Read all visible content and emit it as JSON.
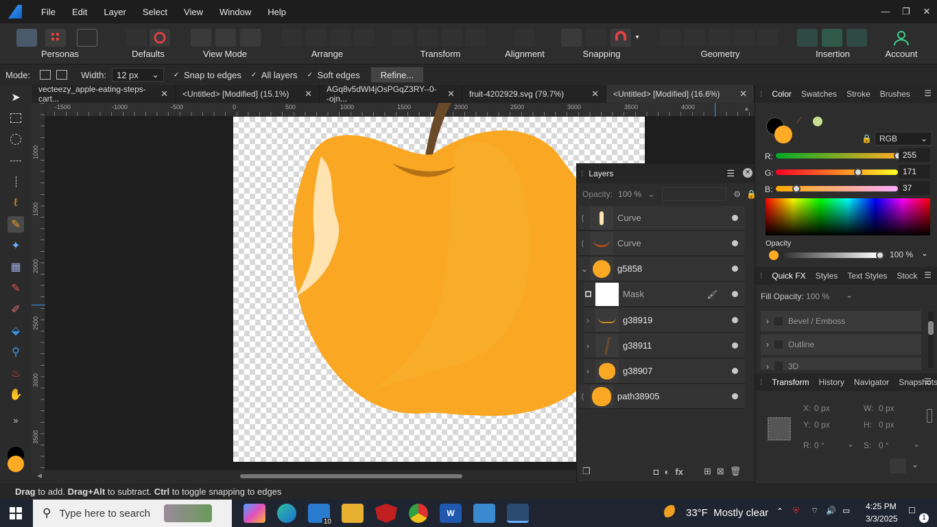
{
  "menu": {
    "items": [
      "File",
      "Edit",
      "Layer",
      "Select",
      "View",
      "Window",
      "Help"
    ],
    "win_min": "—",
    "win_max": "❐",
    "win_close": "✕"
  },
  "toolbar": {
    "personas_label": "Personas",
    "groups": [
      "Defaults",
      "View Mode",
      "Arrange",
      "Transform",
      "Alignment",
      "Snapping",
      "Geometry",
      "Insertion",
      "Account"
    ]
  },
  "context": {
    "mode_label": "Mode:",
    "width_label": "Width:",
    "width_value": "12 px",
    "snap_edges": "Snap to edges",
    "all_layers": "All layers",
    "soft_edges": "Soft edges",
    "refine": "Refine..."
  },
  "tabs": [
    {
      "label": "vecteezy_apple-eating-steps-cart...",
      "close": "✕"
    },
    {
      "label": "<Untitled> [Modified] (15.1%)",
      "close": "✕"
    },
    {
      "label": "AGq8v5dWl4jOsPGqZ3RY--0--ojn...",
      "close": "✕"
    },
    {
      "label": "fruit-4202929.svg (79.7%)",
      "close": "✕"
    },
    {
      "label": "<Untitled> [Modified] (16.6%)",
      "close": "✕"
    }
  ],
  "ruler": {
    "unit": "px",
    "h_ticks": [
      "-1500",
      "-1000",
      "-500",
      "0",
      "500",
      "1000",
      "1500",
      "2000",
      "2500",
      "3000",
      "3500",
      "4000"
    ],
    "v_ticks": [
      "1000",
      "1500",
      "2000",
      "2500",
      "3000",
      "3500"
    ]
  },
  "layers": {
    "title": "Layers",
    "opacity_label": "Opacity:",
    "opacity_value": "100 %",
    "rows": [
      {
        "name": "Curve"
      },
      {
        "name": "Curve"
      },
      {
        "name": "g5858"
      },
      {
        "name": "Mask"
      },
      {
        "name": "g38919"
      },
      {
        "name": "g38911"
      },
      {
        "name": "g38907"
      },
      {
        "name": "path38905"
      }
    ]
  },
  "color_panel": {
    "tabs": [
      "Color",
      "Swatches",
      "Stroke",
      "Brushes"
    ],
    "model": "RGB",
    "r_label": "R:",
    "g_label": "G:",
    "b_label": "B:",
    "r": "255",
    "g": "171",
    "b": "37",
    "opacity_label": "Opacity",
    "opacity_value": "100 %",
    "fill_color": "#FFAB25"
  },
  "fx_panel": {
    "tabs": [
      "Quick FX",
      "Styles",
      "Text Styles",
      "Stock"
    ],
    "fill_opacity_label": "Fill Opacity:",
    "fill_opacity_value": "100 %",
    "effects": [
      "Bevel / Emboss",
      "Outline",
      "3D"
    ]
  },
  "transform_panel": {
    "tabs": [
      "Transform",
      "History",
      "Navigator",
      "Snapshots"
    ],
    "x_label": "X:",
    "x": "0 px",
    "y_label": "Y:",
    "y": "0 px",
    "w_label": "W:",
    "w": "0 px",
    "h_label": "H:",
    "h": "0 px",
    "r_label": "R:",
    "r": "0 °",
    "s_label": "S:",
    "s": "0 °"
  },
  "status": {
    "b1": "Drag",
    "t1": " to add. ",
    "b2": "Drag+Alt",
    "t2": " to subtract. ",
    "b3": "Ctrl",
    "t3": " to toggle snapping to edges"
  },
  "taskbar": {
    "search_placeholder": "Type here to search",
    "weather": "33°F  Mostly clear",
    "time": "4:25 PM",
    "date": "3/3/2025",
    "notif_count": "1",
    "mail_badge": "10"
  }
}
